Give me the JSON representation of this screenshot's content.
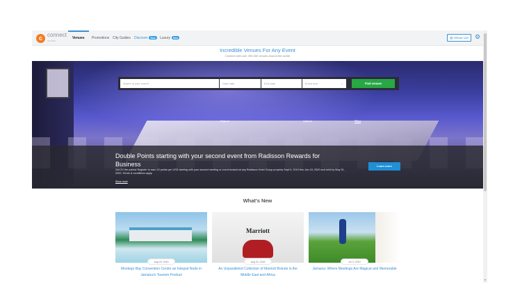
{
  "brand": {
    "mark": "c",
    "name": "connect",
    "tagline": "GLOBAL"
  },
  "nav": {
    "items": [
      {
        "label": "Venues",
        "active": true
      },
      {
        "label": "Promotions"
      },
      {
        "label": "City Guides"
      },
      {
        "label": "Discover",
        "badge": "New"
      },
      {
        "label": "Luxury",
        "badge": "New"
      }
    ],
    "venue_list_label": "Venue List",
    "settings_icon": "gear-icon"
  },
  "headline": "Incredible Venues For Any Event",
  "subline": "Connect with over 250,000 venues around the world!",
  "search": {
    "where_placeholder": "Where is your event?",
    "start_placeholder": "Start date",
    "end_placeholder": "End date",
    "size_placeholder": "Event size",
    "find_label": "Find venues",
    "optional_label": "Optional",
    "filter_label": "Filter"
  },
  "promo": {
    "title": "Double Points starting with your second event from Radisson Rewards for Business",
    "body": "Get 2X the points! Register to earn 10 points per USD starting with your second meeting or event booked at any Radisson Hotel Group property Sept 9, 2019 thru Jan 15, 2020 and held by May 31, 2020. Terms & conditions apply.",
    "show_more": "Show more",
    "button": "Learn more"
  },
  "whats_new": {
    "heading": "What's New",
    "cards": [
      {
        "date": "Aug 20, 2019",
        "title": "Montego Bay Convention Centre an Integral Node in Jamaica's Tourism Product"
      },
      {
        "date": "Aug 20, 2019",
        "title": "An Unparalleled Collection of Marriott Brands in the Middle East and Africa",
        "logo": "Marriott"
      },
      {
        "date": "Jul 3, 2019",
        "title": "Jamaica: Where Meetings Are Magical and Memorable"
      }
    ]
  },
  "colors": {
    "accent": "#3a8fd1",
    "brand": "#f47b20",
    "find": "#28a745",
    "cta": "#1f8fd6"
  }
}
